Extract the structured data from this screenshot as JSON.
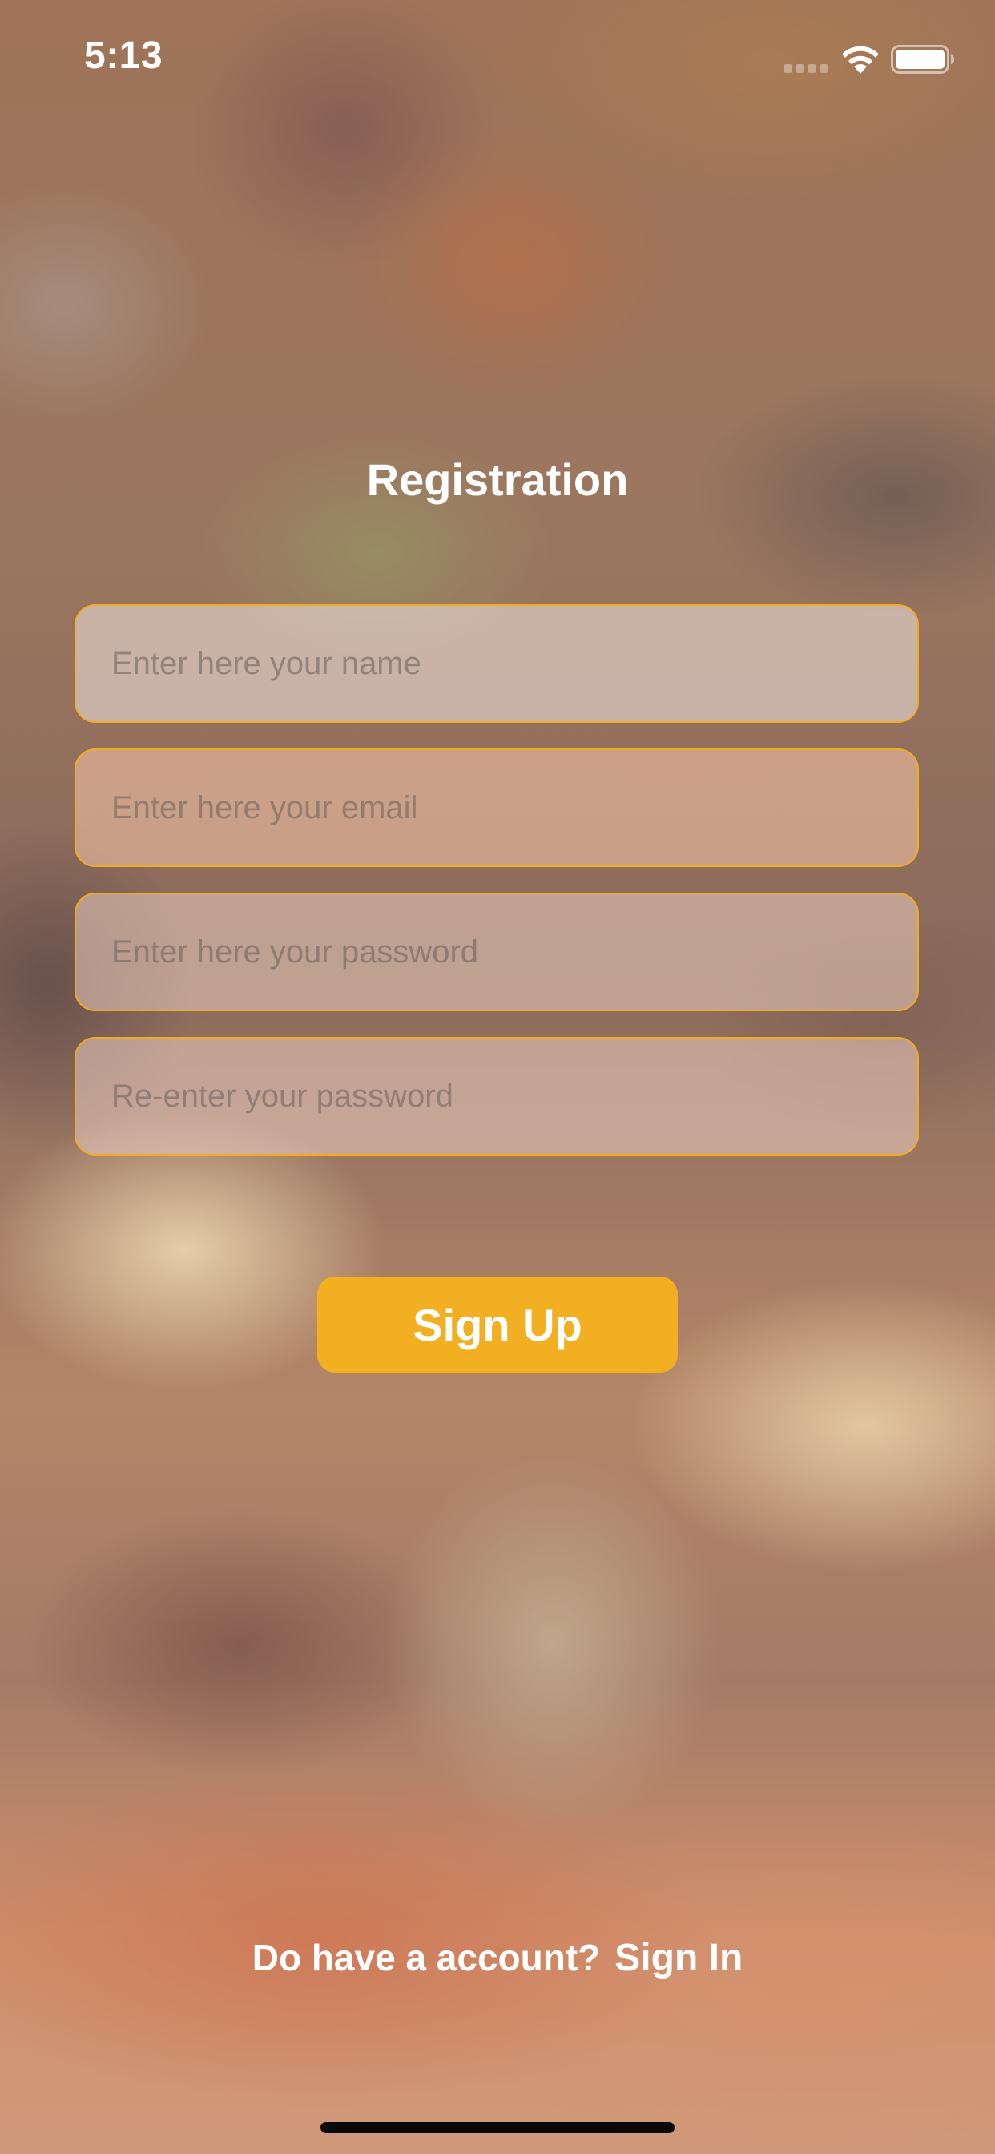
{
  "status_bar": {
    "time": "5:13"
  },
  "registration": {
    "title": "Registration",
    "fields": {
      "name": {
        "placeholder": "Enter here your name",
        "value": ""
      },
      "email": {
        "placeholder": "Enter here your email",
        "value": ""
      },
      "password": {
        "placeholder": "Enter here your password",
        "value": ""
      },
      "confirm_password": {
        "placeholder": "Re-enter your password",
        "value": ""
      }
    },
    "signup_button": "Sign Up"
  },
  "footer": {
    "prompt": "Do have a account?",
    "signin_link": "Sign In"
  },
  "colors": {
    "accent": "#f2af22",
    "field_border": "#f1ad22",
    "text": "#ffffff"
  },
  "icons": {
    "signal": "cellular-signal-icon",
    "wifi": "wifi-icon",
    "battery": "battery-icon"
  }
}
